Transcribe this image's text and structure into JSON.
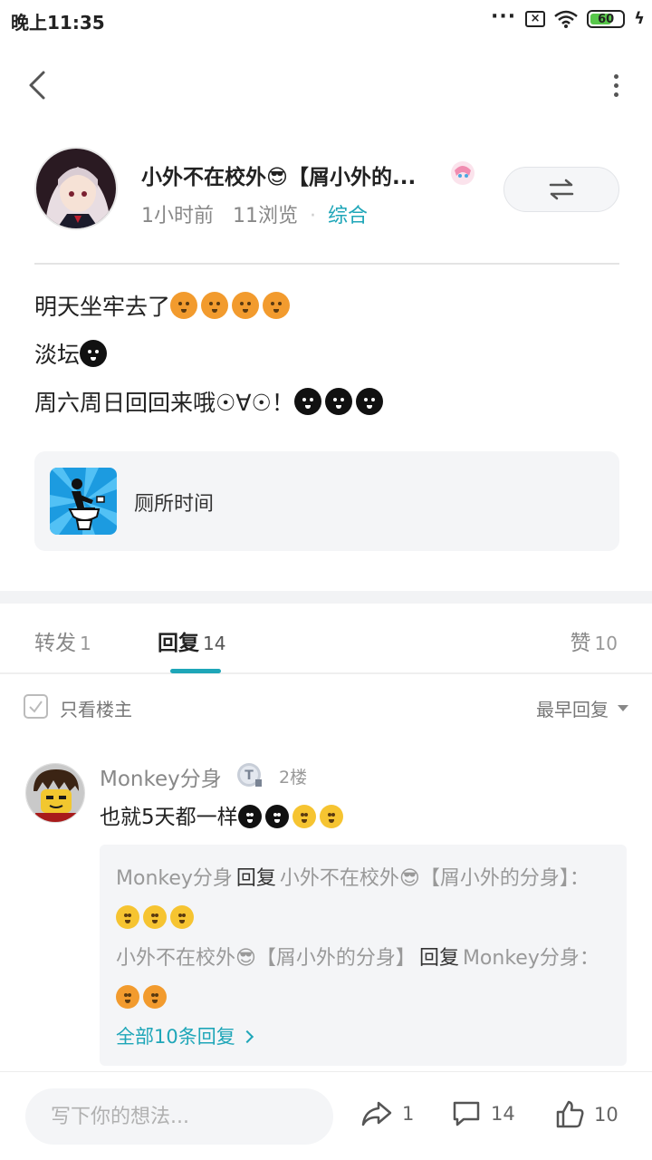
{
  "status": {
    "time": "晚上11:35",
    "battery": "60"
  },
  "author": {
    "name": "小外不在校外😎【屑小外的...",
    "time_ago": "1小时前",
    "views": "11浏览",
    "category": "综合"
  },
  "post": {
    "line1": "明天坐牢去了",
    "line2": "淡坛",
    "line3": "周六周日回回来哦☉∀☉！"
  },
  "topic": {
    "label": "厕所时间"
  },
  "tabs": {
    "repost_label": "转发",
    "repost_count": "1",
    "reply_label": "回复",
    "reply_count": "14",
    "like_label": "赞",
    "like_count": "10"
  },
  "filter": {
    "only_op": "只看楼主",
    "sort": "最早回复"
  },
  "comment": {
    "name": "Monkey分身",
    "floor": "2楼",
    "text": "也就5天都一样",
    "replies": [
      {
        "who": "Monkey分身",
        "verb": "回复",
        "target": "小外不在校外😎【屑小外的分身】："
      },
      {
        "who": "小外不在校外😎【屑小外的分身】",
        "verb": "回复",
        "target": "Monkey分身："
      }
    ],
    "all_replies": "全部10条回复"
  },
  "bottom": {
    "placeholder": "写下你的想法...",
    "share_count": "1",
    "comment_count": "14",
    "like_count": "10"
  },
  "colors": {
    "accent": "#1ea6b8"
  }
}
